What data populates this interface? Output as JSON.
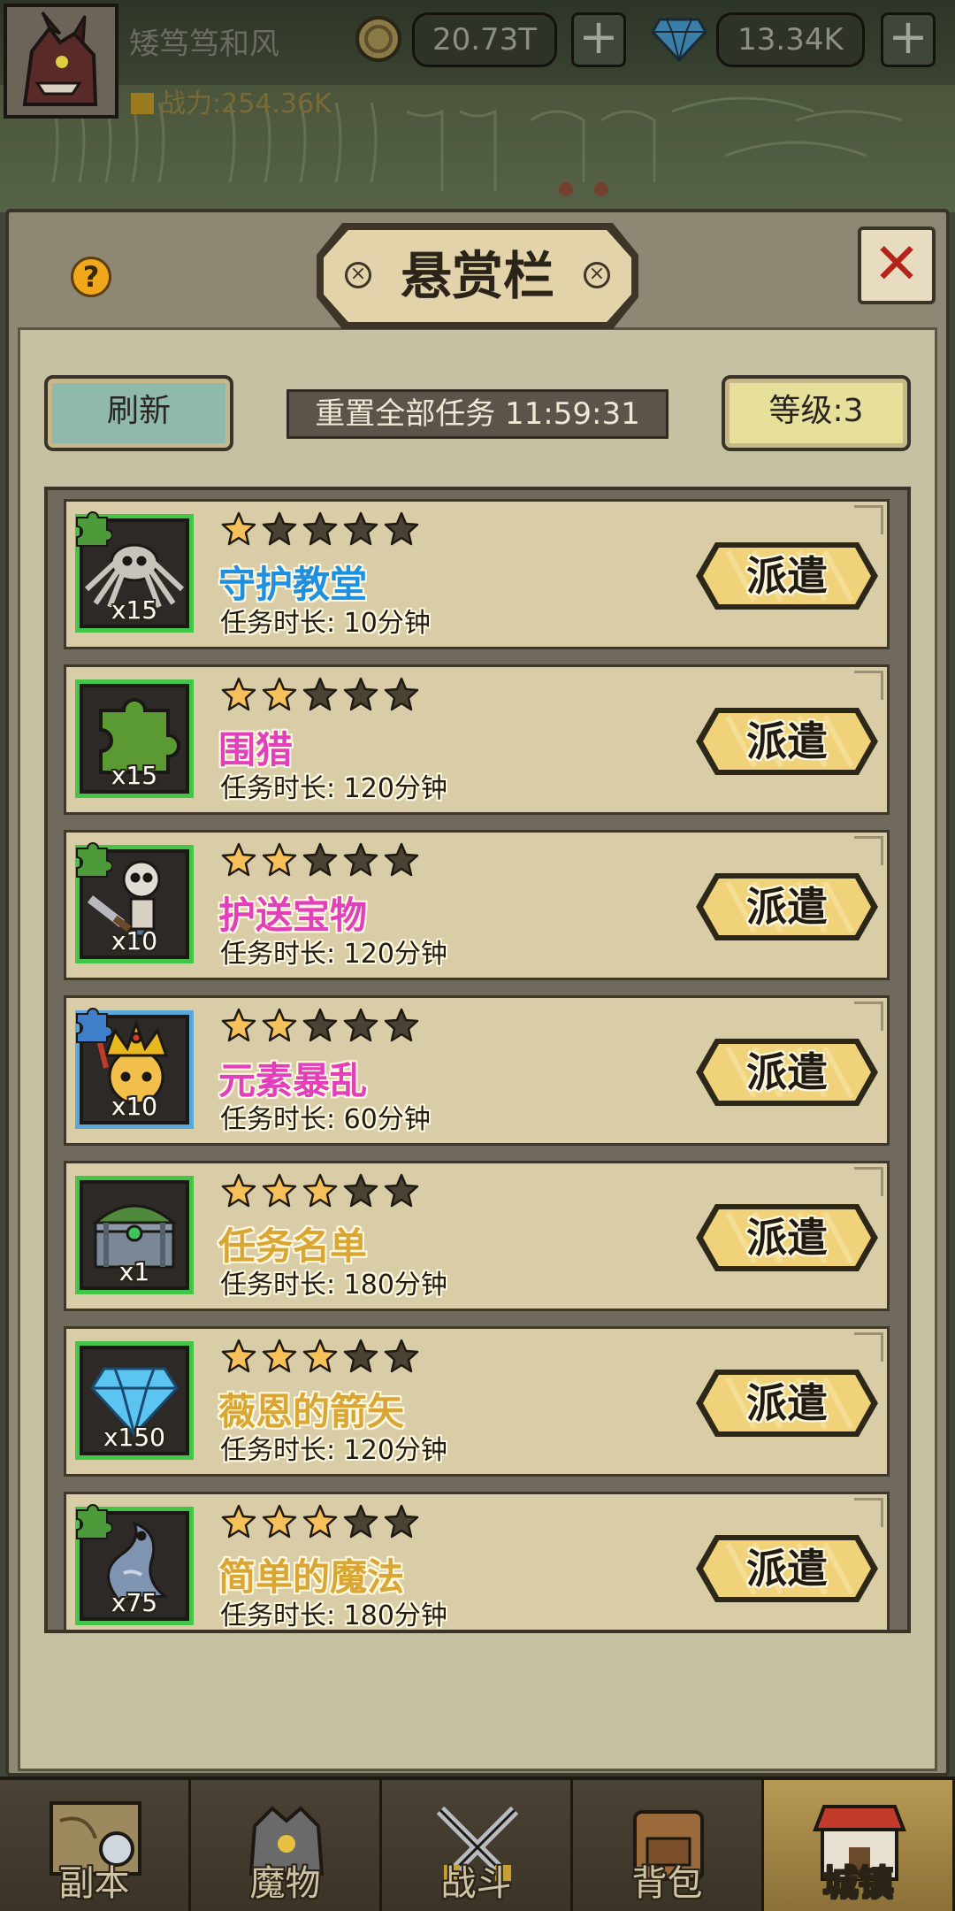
{
  "header": {
    "player_name": "矮笃笃和风",
    "power": "战力:254.36K",
    "gold": "20.73T",
    "gems": "13.34K",
    "gold_plus": "+",
    "gems_plus": "+"
  },
  "panel": {
    "title": "悬赏栏",
    "help": "?",
    "close": "✕",
    "refresh_label": "刷新",
    "reset_timer": "重置全部任务 11:59:31",
    "level_label": "等级:3"
  },
  "quests": [
    {
      "name": "守护教堂",
      "name_color": "#1f8fe0",
      "duration": "任务时长:  10分钟",
      "count": "x15",
      "stars": 1,
      "frame": "green",
      "tag": "green",
      "reward_icon": "spider-icon",
      "button": "派遣"
    },
    {
      "name": "围猎",
      "name_color": "#e23fbb",
      "duration": "任务时长:  120分钟",
      "count": "x15",
      "stars": 2,
      "frame": "green",
      "tag": "none",
      "reward_icon": "puzzle-piece-icon",
      "button": "派遣"
    },
    {
      "name": "护送宝物",
      "name_color": "#e23fbb",
      "duration": "任务时长:  120分钟",
      "count": "x10",
      "stars": 2,
      "frame": "green",
      "tag": "green",
      "reward_icon": "skeleton-icon",
      "button": "派遣"
    },
    {
      "name": "元素暴乱",
      "name_color": "#e23fbb",
      "duration": "任务时长:  60分钟",
      "count": "x10",
      "stars": 2,
      "frame": "blue",
      "tag": "blue",
      "reward_icon": "crowned-king-icon",
      "button": "派遣"
    },
    {
      "name": "任务名单",
      "name_color": "#d9a533",
      "duration": "任务时长:  180分钟",
      "count": "x1",
      "stars": 3,
      "frame": "green",
      "tag": "none",
      "reward_icon": "treasure-chest-icon",
      "button": "派遣"
    },
    {
      "name": "薇恩的箭矢",
      "name_color": "#d9a533",
      "duration": "任务时长:  120分钟",
      "count": "x150",
      "stars": 3,
      "frame": "green",
      "tag": "none",
      "reward_icon": "diamond-icon",
      "button": "派遣"
    },
    {
      "name": "简单的魔法",
      "name_color": "#d9a533",
      "duration": "任务时长:  180分钟",
      "count": "x75",
      "stars": 3,
      "frame": "green",
      "tag": "green",
      "reward_icon": "serpent-icon",
      "button": "派遣"
    }
  ],
  "nav": [
    {
      "label": "副本",
      "icon": "map-icon",
      "active": false
    },
    {
      "label": "魔物",
      "icon": "monster-icon",
      "active": false
    },
    {
      "label": "战斗",
      "icon": "crossed-swords-icon",
      "active": false
    },
    {
      "label": "背包",
      "icon": "backpack-icon",
      "active": false
    },
    {
      "label": "城镇",
      "icon": "town-icon",
      "active": true
    }
  ],
  "colors": {
    "star_on": "#f6c15a",
    "star_off": "#4a4232",
    "dispatch_fill": "#f0d27a",
    "frame_green": "#44c548",
    "frame_blue": "#5aa7db"
  }
}
